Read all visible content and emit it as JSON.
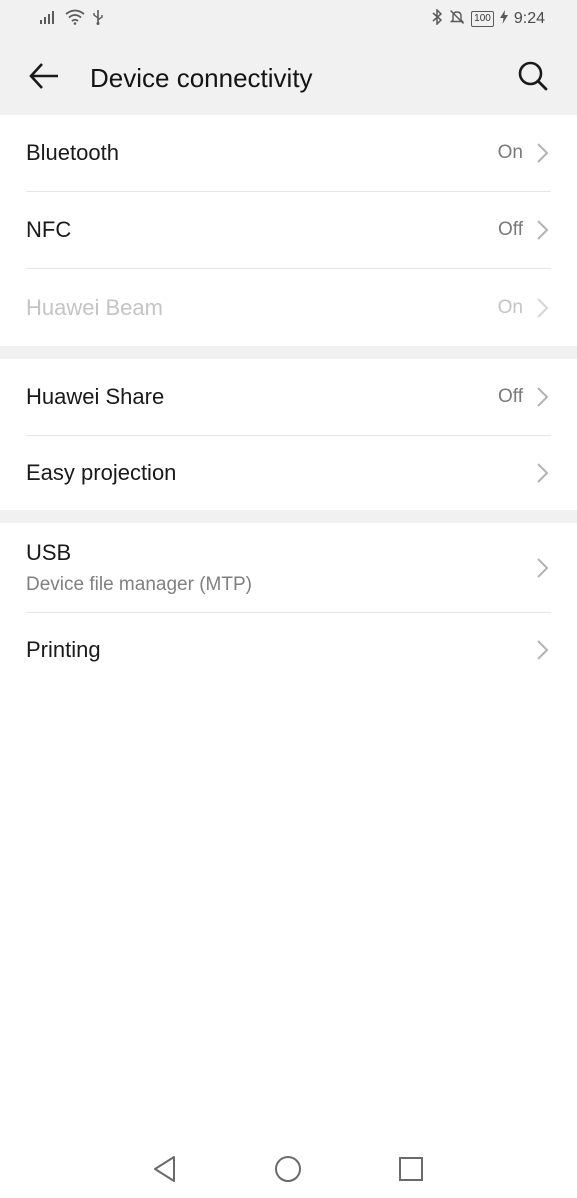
{
  "status_bar": {
    "time": "9:24",
    "battery": "100",
    "icons": [
      "signal-icon",
      "wifi-icon",
      "usb-icon",
      "bluetooth-icon",
      "mute-icon",
      "battery-icon",
      "charging-icon"
    ]
  },
  "header": {
    "title": "Device connectivity",
    "back_icon": "arrow-left-icon",
    "search_icon": "search-icon"
  },
  "groups": [
    {
      "items": [
        {
          "label": "Bluetooth",
          "value": "On",
          "enabled": true
        },
        {
          "label": "NFC",
          "value": "Off",
          "enabled": true
        },
        {
          "label": "Huawei Beam",
          "value": "On",
          "enabled": false
        }
      ]
    },
    {
      "items": [
        {
          "label": "Huawei Share",
          "value": "Off",
          "enabled": true
        },
        {
          "label": "Easy projection",
          "value": "",
          "enabled": true
        }
      ]
    },
    {
      "items": [
        {
          "label": "USB",
          "subtitle": "Device file manager (MTP)",
          "enabled": true
        },
        {
          "label": "Printing",
          "value": "",
          "enabled": true
        }
      ]
    }
  ],
  "nav_bar": {
    "icons": [
      "back-triangle-icon",
      "home-circle-icon",
      "recents-square-icon"
    ]
  },
  "colors": {
    "header_bg": "#f1f1f1",
    "divider": "#e6e6e6",
    "text_primary": "#1a1a1a",
    "text_secondary": "#7a7a7a",
    "text_disabled": "#c4c4c4"
  }
}
